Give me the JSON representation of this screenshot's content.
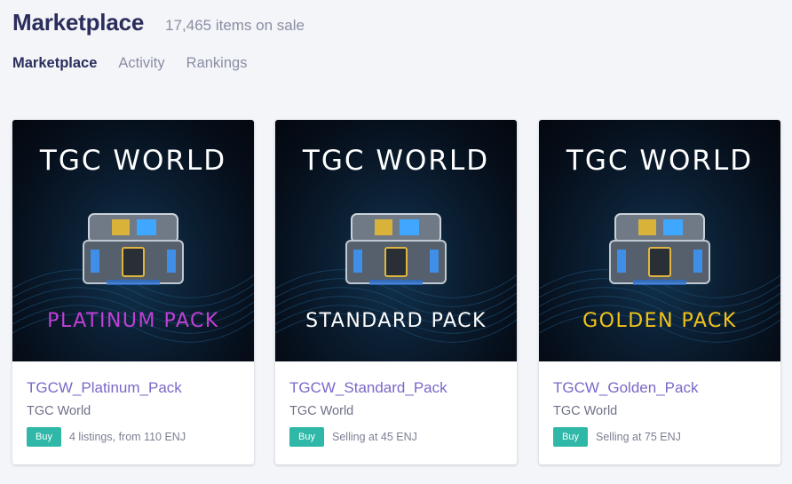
{
  "header": {
    "title": "Marketplace",
    "subtitle": "17,465 items on sale"
  },
  "tabs": [
    {
      "label": "Marketplace",
      "active": true
    },
    {
      "label": "Activity",
      "active": false
    },
    {
      "label": "Rankings",
      "active": false
    }
  ],
  "cards": [
    {
      "art_brand": "TGC WORLD",
      "art_pack": "PLATINUM PACK",
      "art_pack_color": "#c23fd8",
      "name": "TGCW_Platinum_Pack",
      "creator": "TGC World",
      "buy_label": "Buy",
      "price_text": "4 listings, from 110 ENJ"
    },
    {
      "art_brand": "TGC WORLD",
      "art_pack": "STANDARD PACK",
      "art_pack_color": "#ffffff",
      "name": "TGCW_Standard_Pack",
      "creator": "TGC World",
      "buy_label": "Buy",
      "price_text": "Selling at 45 ENJ"
    },
    {
      "art_brand": "TGC WORLD",
      "art_pack": "GOLDEN PACK",
      "art_pack_color": "#f2c418",
      "name": "TGCW_Golden_Pack",
      "creator": "TGC World",
      "buy_label": "Buy",
      "price_text": "Selling at 75 ENJ"
    }
  ],
  "colors": {
    "accent_link": "#7b68c7",
    "buy_button": "#2fb8a7",
    "title": "#2b2d5c"
  }
}
